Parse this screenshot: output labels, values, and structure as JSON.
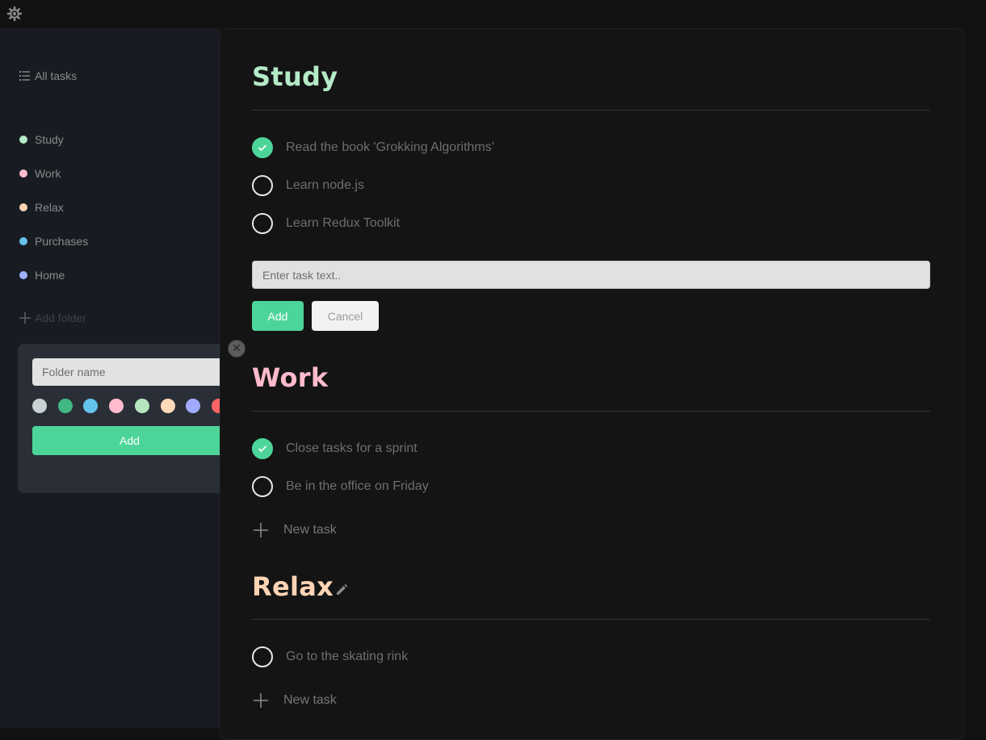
{
  "theme_icon": "gear-icon",
  "sidebar": {
    "all_tasks_label": "All tasks",
    "folders": [
      {
        "label": "Study",
        "color": "#b4eac7"
      },
      {
        "label": "Work",
        "color": "#ffbbcc"
      },
      {
        "label": "Relax",
        "color": "#ffd4b5"
      },
      {
        "label": "Purchases",
        "color": "#64c4ed"
      },
      {
        "label": "Home",
        "color": "#9fb0ff"
      }
    ],
    "add_folder_label": "Add folder"
  },
  "popup": {
    "placeholder": "Folder name",
    "colors": [
      "#c9d1d3",
      "#42b883",
      "#64c4ed",
      "#ffbbcc",
      "#b6e6bd",
      "#ffdab9",
      "#a0aaff",
      "#ff6464"
    ],
    "add_label": "Add",
    "close_symbol": "✕"
  },
  "sections": [
    {
      "title": "Study",
      "color": "#b4eac7",
      "tasks": [
        {
          "text": "Read the book 'Grokking Algorithms'",
          "done": true
        },
        {
          "text": "Learn node.js",
          "done": false
        },
        {
          "text": "Learn Redux Toolkit",
          "done": false
        }
      ],
      "input_placeholder": "Enter task text..",
      "add_label": "Add",
      "cancel_label": "Cancel"
    },
    {
      "title": "Work",
      "color": "#ffbbcc",
      "tasks": [
        {
          "text": "Close tasks for a sprint",
          "done": true
        },
        {
          "text": "Be in the office on Friday",
          "done": false
        }
      ],
      "new_task_label": "New task"
    },
    {
      "title": "Relax",
      "color": "#ffd4b5",
      "tasks": [
        {
          "text": "Go to the skating rink",
          "done": false
        }
      ],
      "new_task_label": "New task"
    }
  ]
}
